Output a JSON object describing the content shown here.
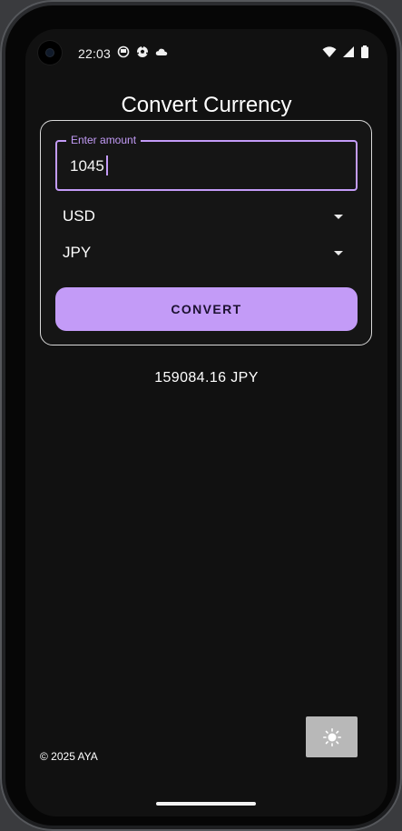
{
  "status_bar": {
    "time": "22:03",
    "left_icons": [
      "notification-icon",
      "soccer-ball-icon",
      "cloud-icon"
    ],
    "right_icons": [
      "wifi-icon",
      "cell-signal-icon",
      "battery-icon"
    ]
  },
  "app": {
    "title": "Convert Currency",
    "amount_field": {
      "label": "Enter amount",
      "value": "1045"
    },
    "from_currency": {
      "selected": "USD"
    },
    "to_currency": {
      "selected": "JPY"
    },
    "convert_label": "CONVERT",
    "result": "159084.16 JPY",
    "footer": "© 2025 AYA",
    "theme_toggle_icon": "sun-icon"
  },
  "colors": {
    "accent": "#c39bf7",
    "background": "#111111",
    "card_border": "#d9d9d9"
  }
}
